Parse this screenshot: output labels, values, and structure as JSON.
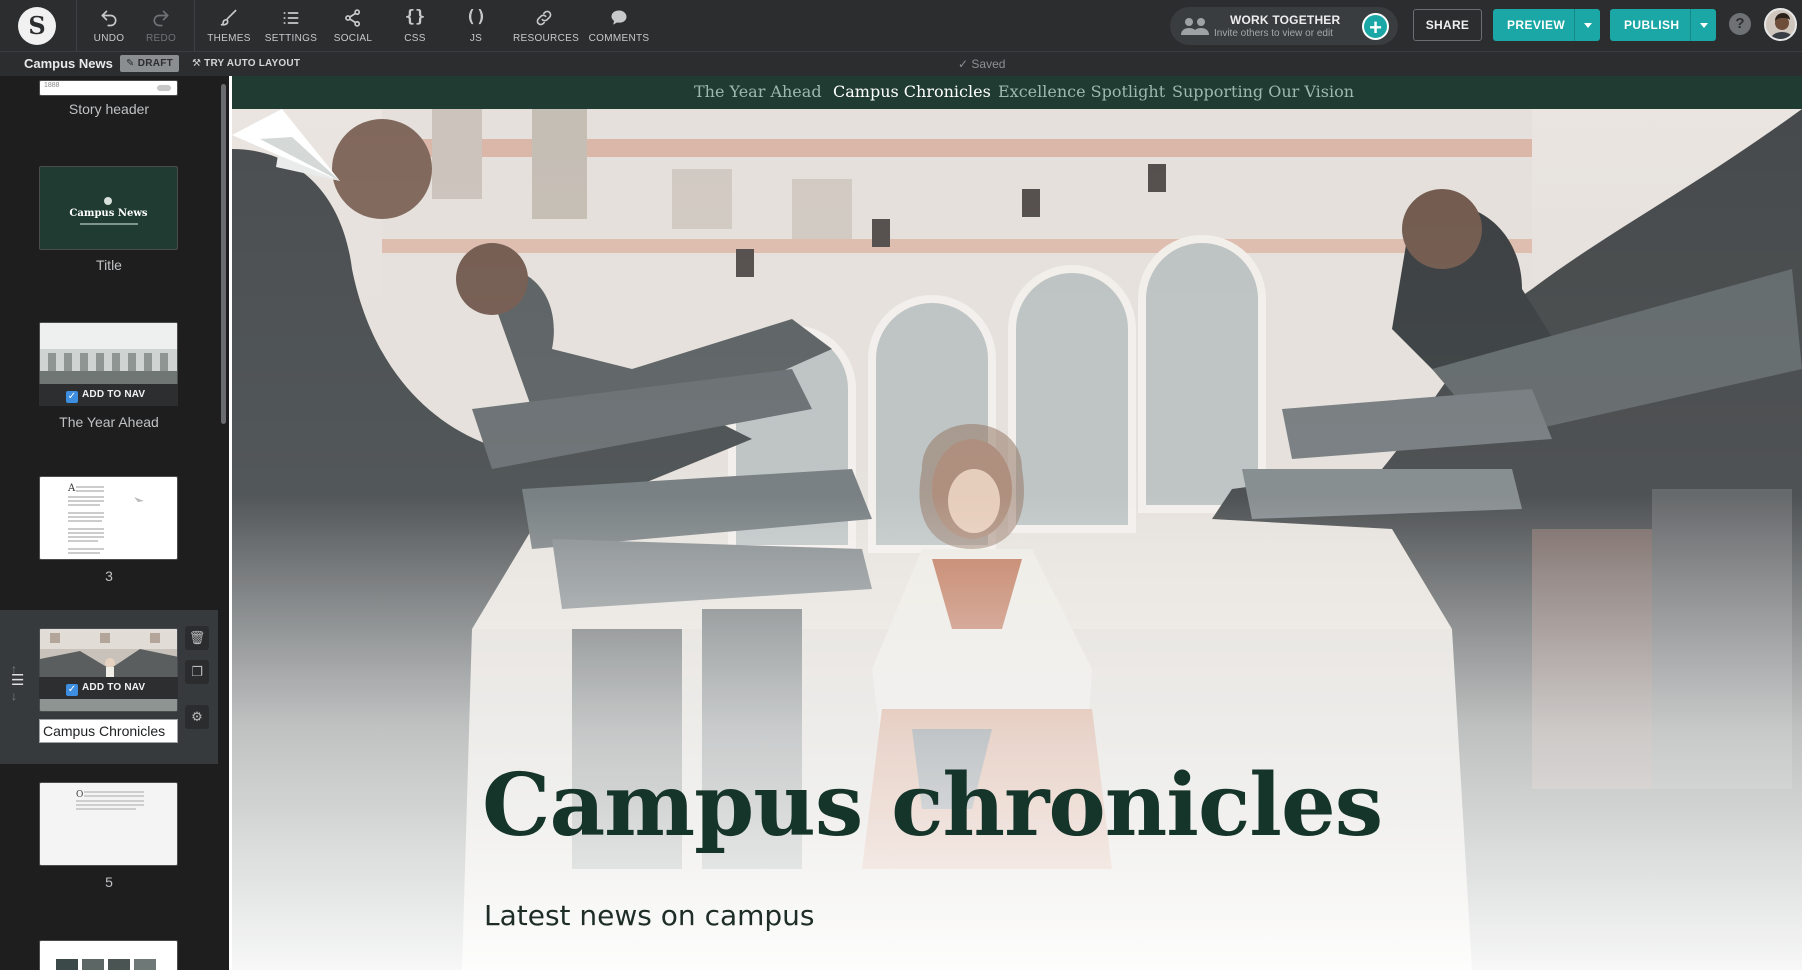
{
  "toolbar": {
    "logo_letter": "S",
    "tools": [
      {
        "id": "undo",
        "label": "UNDO",
        "icon": "undo-icon"
      },
      {
        "id": "redo",
        "label": "REDO",
        "icon": "redo-icon",
        "disabled": true
      },
      {
        "id": "themes",
        "label": "THEMES",
        "icon": "brush-icon"
      },
      {
        "id": "settings",
        "label": "SETTINGS",
        "icon": "list-icon"
      },
      {
        "id": "social",
        "label": "SOCIAL",
        "icon": "share-nodes-icon"
      },
      {
        "id": "css",
        "label": "CSS",
        "icon": "braces-icon",
        "glyph": "{}"
      },
      {
        "id": "js",
        "label": "JS",
        "icon": "parentheses-icon",
        "glyph": "()"
      },
      {
        "id": "resources",
        "label": "RESOURCES",
        "icon": "link-icon"
      },
      {
        "id": "comments",
        "label": "COMMENTS",
        "icon": "speech-bubble-icon"
      }
    ],
    "work_together": {
      "title": "WORK TOGETHER",
      "subtitle": "Invite others to view or edit",
      "plus": "+"
    },
    "share_label": "SHARE",
    "preview_label": "PREVIEW",
    "publish_label": "PUBLISH",
    "help_glyph": "?"
  },
  "subbar": {
    "story_name": "Campus News",
    "draft_label": "DRAFT",
    "auto_layout_label": "TRY AUTO LAYOUT",
    "saved_label": "Saved"
  },
  "sidebar": {
    "header_thumb_text": "1888",
    "title_thumb_text": "Campus News",
    "slides": [
      {
        "caption": "Story header"
      },
      {
        "caption": "Title"
      },
      {
        "caption": "The Year Ahead",
        "nav_label": "ADD TO NAV"
      },
      {
        "caption": "3"
      },
      {
        "caption": "Campus Chronicles",
        "nav_label": "ADD TO NAV"
      },
      {
        "caption": "5"
      }
    ]
  },
  "story_nav": {
    "links": [
      "The Year Ahead",
      "Campus Chronicles",
      "Excellence Spotlight",
      "Supporting Our Vision"
    ]
  },
  "hero": {
    "title": "Campus chronicles",
    "subtitle": "Latest news on campus"
  },
  "colors": {
    "accent": "#1aa7a5",
    "toolbar_bg": "#2b2d2f",
    "story_nav_bg": "#1f3b32",
    "hero_title": "#15342a"
  }
}
